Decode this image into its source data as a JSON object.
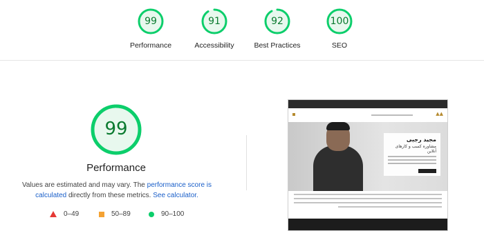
{
  "categories": [
    {
      "label": "Performance",
      "score": "99",
      "fraction": 0.99
    },
    {
      "label": "Accessibility",
      "score": "91",
      "fraction": 0.91
    },
    {
      "label": "Best Practices",
      "score": "92",
      "fraction": 0.92
    },
    {
      "label": "SEO",
      "score": "100",
      "fraction": 1.0
    }
  ],
  "main": {
    "score": "99",
    "fraction": 0.99,
    "title": "Performance",
    "desc_1": "Values are estimated and may vary. The ",
    "desc_link_1": "performance score is calculated",
    "desc_2": " directly from these metrics. ",
    "desc_link_2": "See calculator.",
    "desc_3": ""
  },
  "legend": [
    {
      "range": "0–49",
      "icon": "fail-triangle-icon"
    },
    {
      "range": "50–89",
      "icon": "average-square-icon"
    },
    {
      "range": "90–100",
      "icon": "pass-circle-icon"
    }
  ],
  "thumbnail": {
    "name": "مجید رجبی",
    "subtitle": "مشاوره کسب و کارهای آنلاین"
  },
  "colors": {
    "pass_stroke": "#0cce6b",
    "pass_fill": "#e8f8ee",
    "pass_text": "#0a7a2f",
    "fail": "#e53935",
    "average": "#f4a233",
    "link": "#1a5fc9"
  }
}
